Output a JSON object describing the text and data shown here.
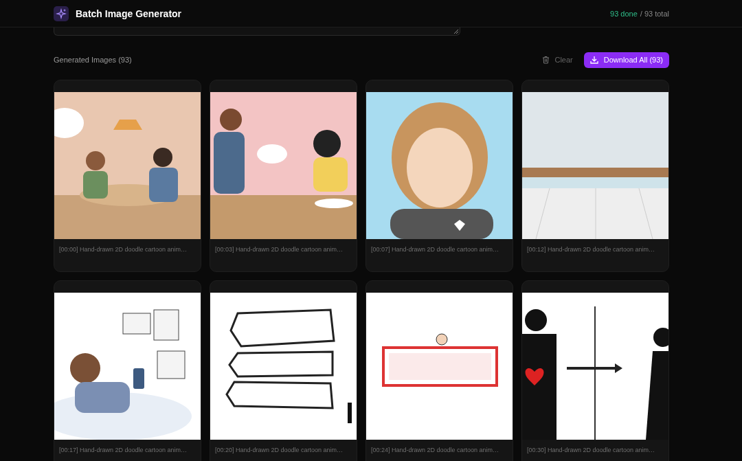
{
  "app": {
    "title": "Batch Image Generator",
    "done": "93 done",
    "total": "/ 93 total"
  },
  "gallery": {
    "title": "Generated Images (93)",
    "clear": "Clear",
    "download": "Download All (93)",
    "images": [
      {
        "caption": "[00:00] Hand-drawn 2D doodle cartoon anim…",
        "kind": "picture"
      },
      {
        "caption": "[00:03] Hand-drawn 2D doodle cartoon anim…",
        "kind": "picture"
      },
      {
        "caption": "[00:07] Hand-drawn 2D doodle cartoon anim…",
        "kind": "picture"
      },
      {
        "caption": "[00:12] Hand-drawn 2D doodle cartoon anim…",
        "kind": "picture"
      },
      {
        "caption": "[00:17] Hand-drawn 2D doodle cartoon anim…",
        "kind": "picture"
      },
      {
        "caption": "[00:20] Hand-drawn 2D doodle cartoon anim…",
        "kind": "picture"
      },
      {
        "caption": "[00:24] Hand-drawn 2D doodle cartoon anim…",
        "kind": "picture"
      },
      {
        "caption": "[00:30] Hand-drawn 2D doodle cartoon anim…",
        "kind": "picture"
      }
    ]
  }
}
